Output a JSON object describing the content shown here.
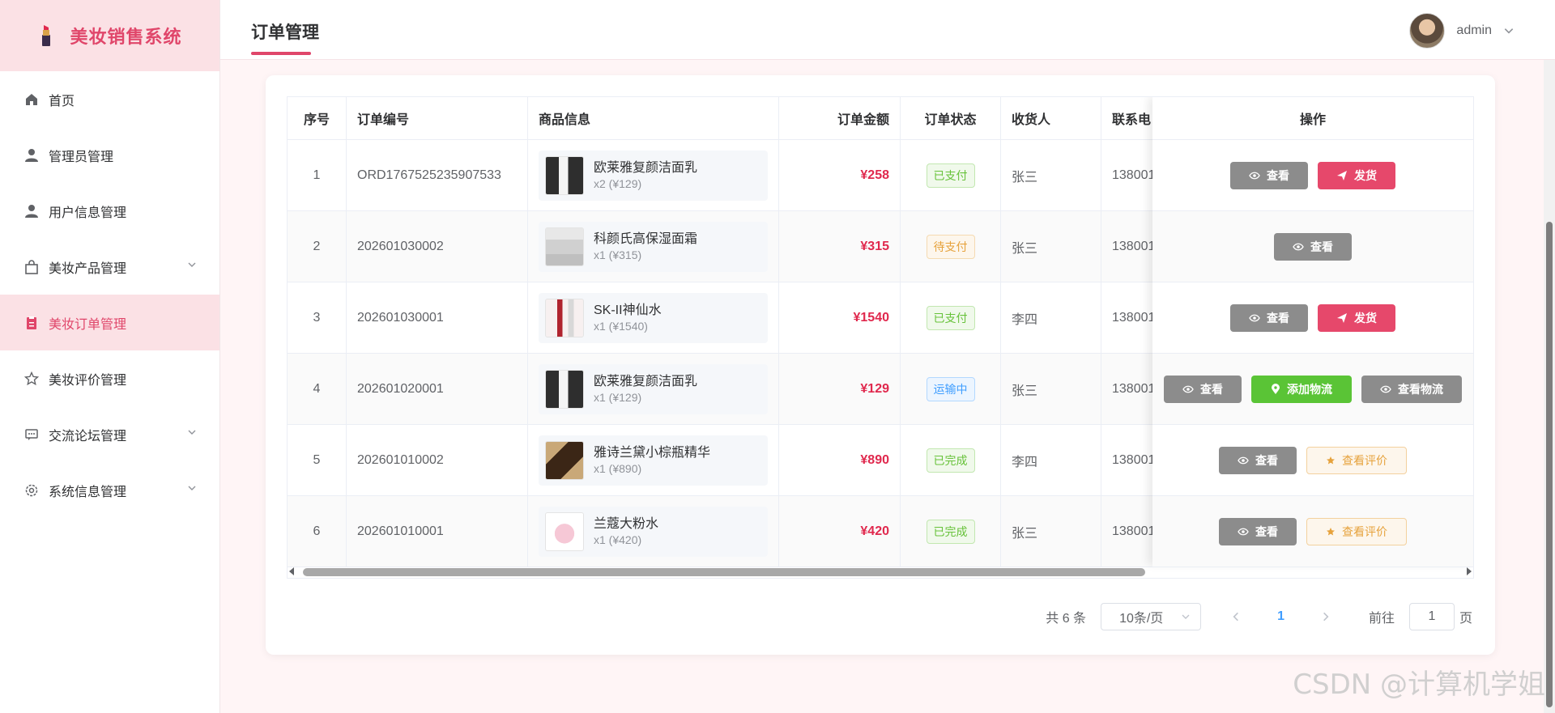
{
  "app": {
    "title": "美妆销售系统"
  },
  "sidebar": {
    "items": [
      {
        "label": "首页",
        "icon": "home-icon",
        "active": false,
        "expandable": false
      },
      {
        "label": "管理员管理",
        "icon": "user-icon",
        "active": false,
        "expandable": false
      },
      {
        "label": "用户信息管理",
        "icon": "user-icon",
        "active": false,
        "expandable": false
      },
      {
        "label": "美妆产品管理",
        "icon": "shopping-bag-icon",
        "active": false,
        "expandable": true
      },
      {
        "label": "美妆订单管理",
        "icon": "clipboard-icon",
        "active": true,
        "expandable": false
      },
      {
        "label": "美妆评价管理",
        "icon": "star-icon",
        "active": false,
        "expandable": false
      },
      {
        "label": "交流论坛管理",
        "icon": "chat-icon",
        "active": false,
        "expandable": true
      },
      {
        "label": "系统信息管理",
        "icon": "gear-icon",
        "active": false,
        "expandable": true
      }
    ]
  },
  "header": {
    "title": "订单管理",
    "user": "admin"
  },
  "table": {
    "columns": [
      "序号",
      "订单编号",
      "商品信息",
      "订单金额",
      "订单状态",
      "收货人",
      "联系电",
      "操作"
    ],
    "rows": [
      {
        "idx": "1",
        "order_no": "ORD1767525235907533",
        "product": "欧莱雅复颜洁面乳",
        "qty": "x2 (¥129)",
        "amount": "¥258",
        "status": "已支付",
        "receiver": "张三",
        "phone": "138001",
        "actions": [
          "查看",
          "发货"
        ]
      },
      {
        "idx": "2",
        "order_no": "202601030002",
        "product": "科颜氏高保湿面霜",
        "qty": "x1 (¥315)",
        "amount": "¥315",
        "status": "待支付",
        "receiver": "张三",
        "phone": "138001",
        "actions": [
          "查看"
        ]
      },
      {
        "idx": "3",
        "order_no": "202601030001",
        "product": "SK-II神仙水",
        "qty": "x1 (¥1540)",
        "amount": "¥1540",
        "status": "已支付",
        "receiver": "李四",
        "phone": "138001",
        "actions": [
          "查看",
          "发货"
        ]
      },
      {
        "idx": "4",
        "order_no": "202601020001",
        "product": "欧莱雅复颜洁面乳",
        "qty": "x1 (¥129)",
        "amount": "¥129",
        "status": "运输中",
        "receiver": "张三",
        "phone": "138001",
        "actions": [
          "查看",
          "添加物流",
          "查看物流"
        ]
      },
      {
        "idx": "5",
        "order_no": "202601010002",
        "product": "雅诗兰黛小棕瓶精华",
        "qty": "x1 (¥890)",
        "amount": "¥890",
        "status": "已完成",
        "receiver": "李四",
        "phone": "138001",
        "actions": [
          "查看",
          "查看评价"
        ]
      },
      {
        "idx": "6",
        "order_no": "202601010001",
        "product": "兰蔻大粉水",
        "qty": "x1 (¥420)",
        "amount": "¥420",
        "status": "已完成",
        "receiver": "张三",
        "phone": "138001",
        "actions": [
          "查看",
          "查看评价"
        ]
      }
    ]
  },
  "pagination": {
    "total": "共 6 条",
    "page_size": "10条/页",
    "current": "1",
    "goto_label": "前往",
    "goto_value": "1",
    "page_unit": "页"
  },
  "colors": {
    "accent": "#e0466a",
    "paid": "#67c23a",
    "pending": "#e6a23c",
    "shipping": "#409eff"
  },
  "watermark": "CSDN @计算机学姐"
}
